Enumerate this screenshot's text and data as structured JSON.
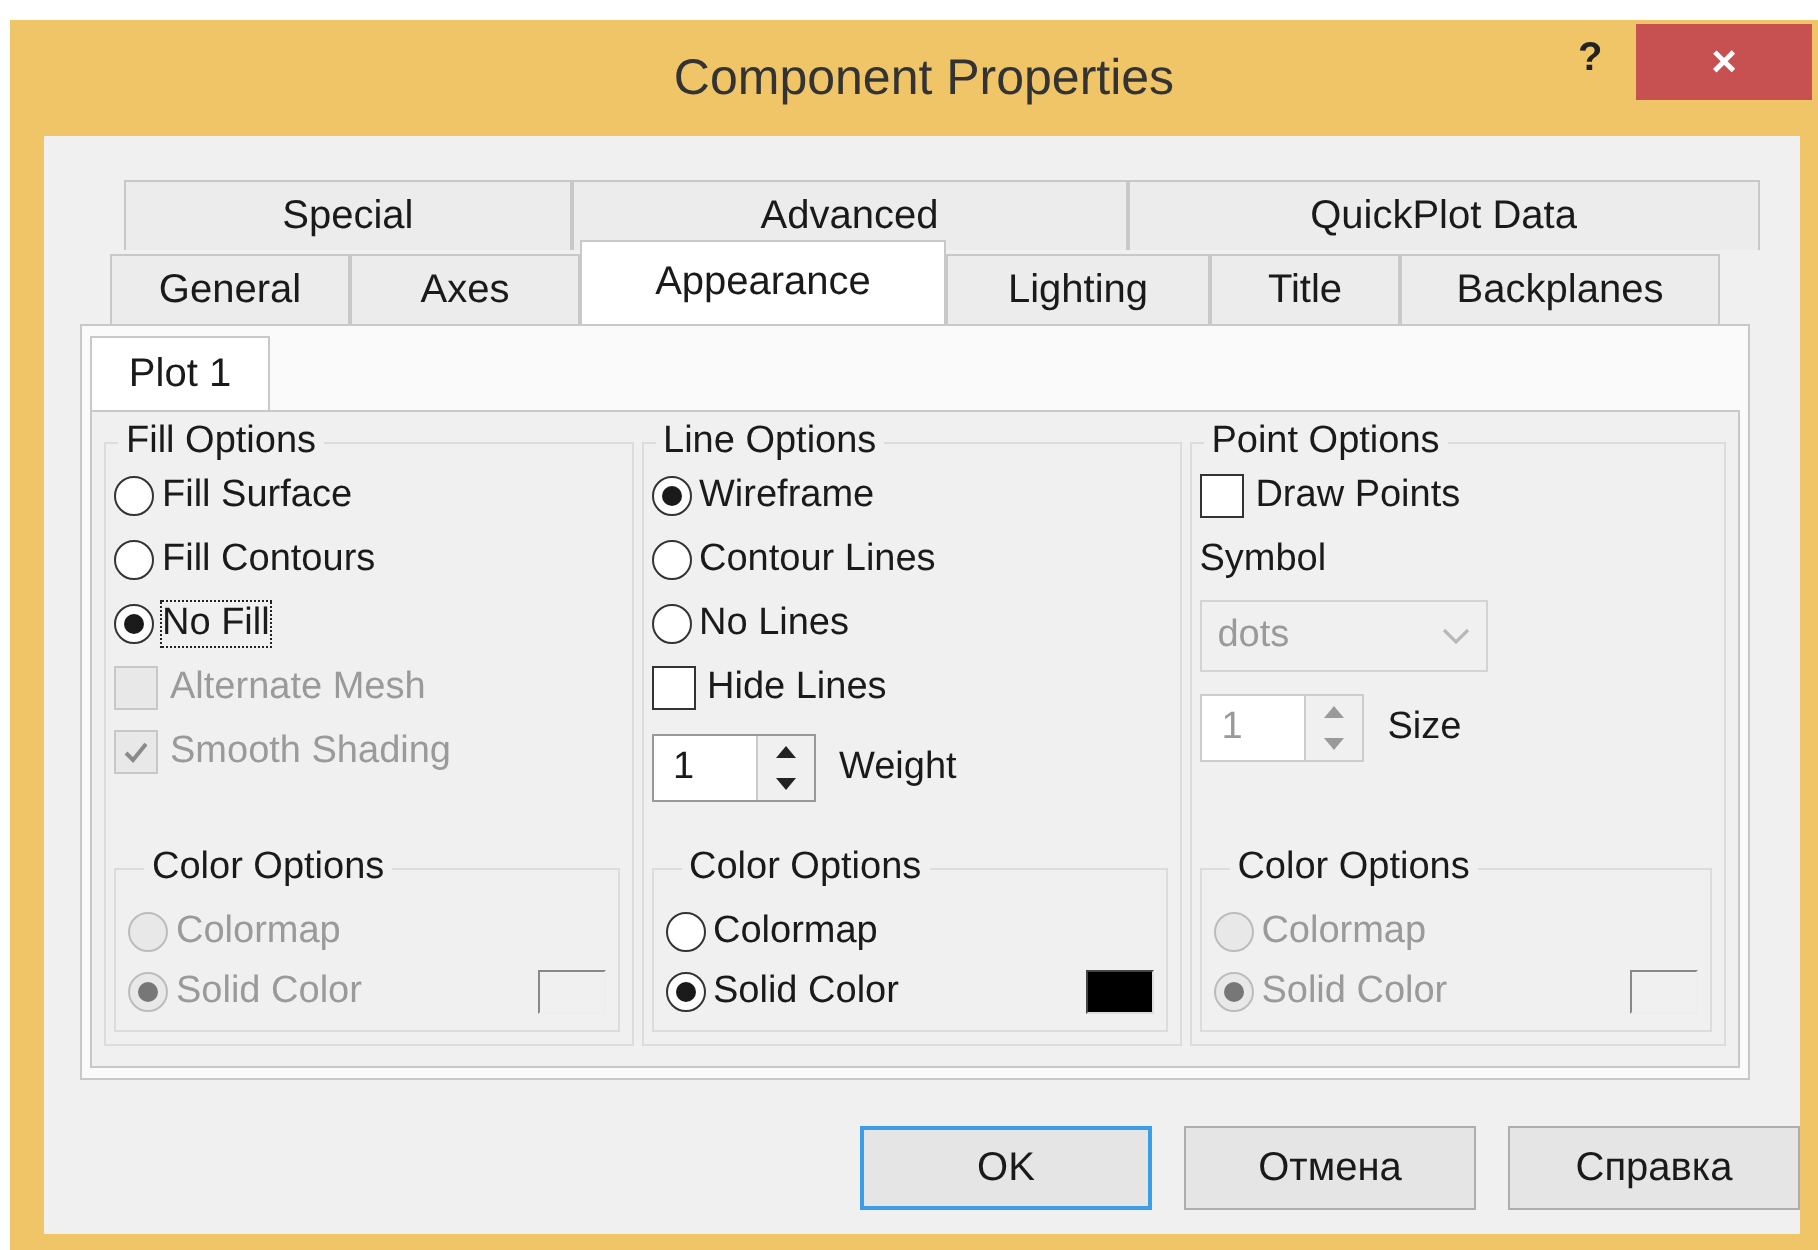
{
  "window": {
    "title": "Component Properties",
    "help": "?",
    "close": "×"
  },
  "tab_rows": [
    [
      {
        "label": "Special",
        "selected": false
      },
      {
        "label": "Advanced",
        "selected": false
      },
      {
        "label": "QuickPlot Data",
        "selected": false
      }
    ],
    [
      {
        "label": "General",
        "selected": false
      },
      {
        "label": "Axes",
        "selected": false
      },
      {
        "label": "Appearance",
        "selected": true
      },
      {
        "label": "Lighting",
        "selected": false
      },
      {
        "label": "Title",
        "selected": false
      },
      {
        "label": "Backplanes",
        "selected": false
      }
    ]
  ],
  "plot_tabs": [
    {
      "label": "Plot 1",
      "selected": true
    }
  ],
  "groups": [
    {
      "title": "Fill Options",
      "controls": [
        {
          "kind": "radio",
          "label": "Fill Surface",
          "selected": false,
          "focused": false,
          "disabled": false
        },
        {
          "kind": "radio",
          "label": "Fill Contours",
          "selected": false,
          "focused": false,
          "disabled": false
        },
        {
          "kind": "radio",
          "label": "No Fill",
          "selected": true,
          "focused": true,
          "disabled": false
        },
        {
          "kind": "checkbox",
          "label": "Alternate Mesh",
          "checked": false,
          "disabled": true
        },
        {
          "kind": "checkbox",
          "label": "Smooth Shading",
          "checked": true,
          "disabled": true
        }
      ],
      "color_options": {
        "title": "Color Options",
        "options": [
          {
            "label": "Colormap",
            "selected": false,
            "disabled": true
          },
          {
            "label": "Solid Color",
            "selected": true,
            "disabled": true
          }
        ],
        "swatch": {
          "disabled": true
        }
      }
    },
    {
      "title": "Line Options",
      "controls": [
        {
          "kind": "radio",
          "label": "Wireframe",
          "selected": true,
          "focused": false,
          "disabled": false
        },
        {
          "kind": "radio",
          "label": "Contour Lines",
          "selected": false,
          "focused": false,
          "disabled": false
        },
        {
          "kind": "radio",
          "label": "No Lines",
          "selected": false,
          "focused": false,
          "disabled": false
        },
        {
          "kind": "checkbox",
          "label": "Hide Lines",
          "checked": false,
          "disabled": false
        },
        {
          "kind": "spin",
          "label": "Weight",
          "spinner": {
            "value": "1",
            "disabled": false
          }
        }
      ],
      "color_options": {
        "title": "Color Options",
        "options": [
          {
            "label": "Colormap",
            "selected": false,
            "disabled": false
          },
          {
            "label": "Solid Color",
            "selected": true,
            "disabled": false
          }
        ],
        "swatch": {
          "disabled": false,
          "color": "#000000"
        }
      }
    },
    {
      "title": "Point Options",
      "controls": [
        {
          "kind": "checkbox",
          "label": "Draw Points",
          "checked": false,
          "disabled": false
        },
        {
          "kind": "label",
          "label": "Symbol"
        },
        {
          "kind": "dropdown",
          "value": "dots",
          "disabled": true
        },
        {
          "kind": "spin",
          "label": "Size",
          "spinner": {
            "value": "1",
            "disabled": true
          }
        }
      ],
      "color_options": {
        "title": "Color Options",
        "options": [
          {
            "label": "Colormap",
            "selected": false,
            "disabled": true
          },
          {
            "label": "Solid Color",
            "selected": true,
            "disabled": true
          }
        ],
        "swatch": {
          "disabled": true
        }
      }
    }
  ],
  "buttons": [
    {
      "label": "OK",
      "default": true
    },
    {
      "label": "Отмена",
      "default": false
    },
    {
      "label": "Справка",
      "default": false
    }
  ]
}
